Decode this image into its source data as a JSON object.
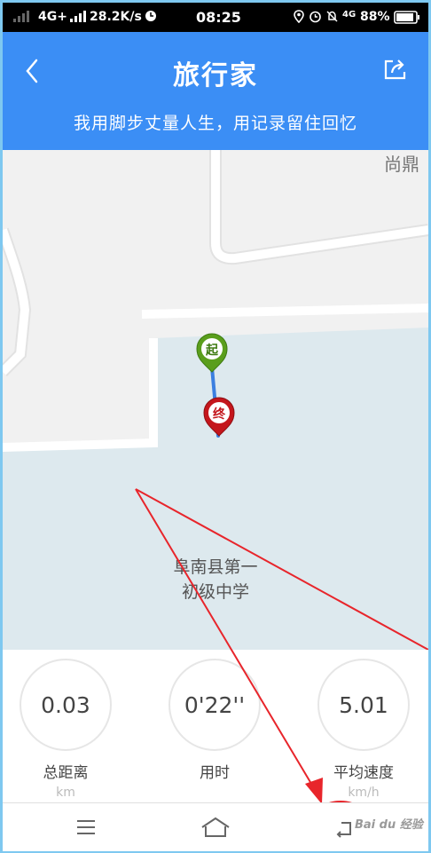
{
  "status_bar": {
    "network": "4G+",
    "speed": "28.2K/s",
    "time": "08:25",
    "network_right": "4G",
    "battery": "88%"
  },
  "header": {
    "title": "旅行家",
    "subtitle": "我用脚步丈量人生，用记录留住回忆",
    "back_icon": "chevron-left-icon",
    "share_icon": "share-icon"
  },
  "map": {
    "corner_label": "尚鼎",
    "school_label_line1": "阜南县第一",
    "school_label_line2": "初级中学",
    "start_marker": "起",
    "end_marker": "终",
    "start_color": "#5a9e1c",
    "end_color": "#c4161c",
    "route_color": "#3b7fe0"
  },
  "stats": [
    {
      "value": "0.03",
      "label": "总距离",
      "unit": "km"
    },
    {
      "value": "0'22''",
      "label": "用时",
      "unit": ""
    },
    {
      "value": "5.01",
      "label": "平均速度",
      "unit": "km/h"
    }
  ],
  "nav": {
    "menu_icon": "menu-icon",
    "home_icon": "home-icon",
    "back_icon": "back-icon"
  },
  "watermark": "Bai du 经验"
}
